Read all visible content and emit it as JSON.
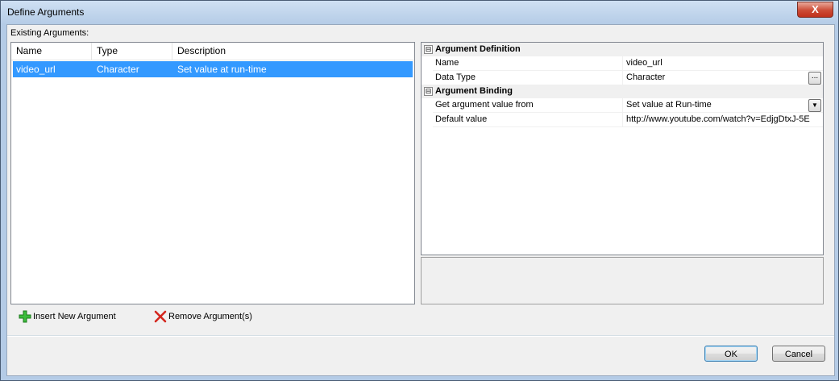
{
  "window": {
    "title": "Define Arguments",
    "close_glyph": "X"
  },
  "existing_label": "Existing Arguments:",
  "list": {
    "columns": [
      "Name",
      "Type",
      "Description"
    ],
    "rows": [
      {
        "name": "video_url",
        "type": "Character",
        "description": "Set value at run-time"
      }
    ]
  },
  "props": {
    "categories": [
      {
        "label": "Argument Definition",
        "toggle": "⊟"
      },
      {
        "label": "Argument Binding",
        "toggle": "⊟"
      }
    ],
    "definition": [
      {
        "key": "Name",
        "value": "video_url"
      },
      {
        "key": "Data Type",
        "value": "Character",
        "button": "..."
      }
    ],
    "binding": [
      {
        "key": "Get argument value from",
        "value": "Set value at Run-time"
      },
      {
        "key": "Default value",
        "value": "http://www.youtube.com/watch?v=EdjgDtxJ-5E"
      }
    ]
  },
  "actions": {
    "insert_label": "Insert New Argument",
    "remove_label": "Remove Argument(s)"
  },
  "buttons": {
    "ok": "OK",
    "cancel": "Cancel"
  },
  "colors": {
    "selection": "#3399ff",
    "insert_icon": "#2eaa2e",
    "remove_icon": "#d3261e"
  }
}
